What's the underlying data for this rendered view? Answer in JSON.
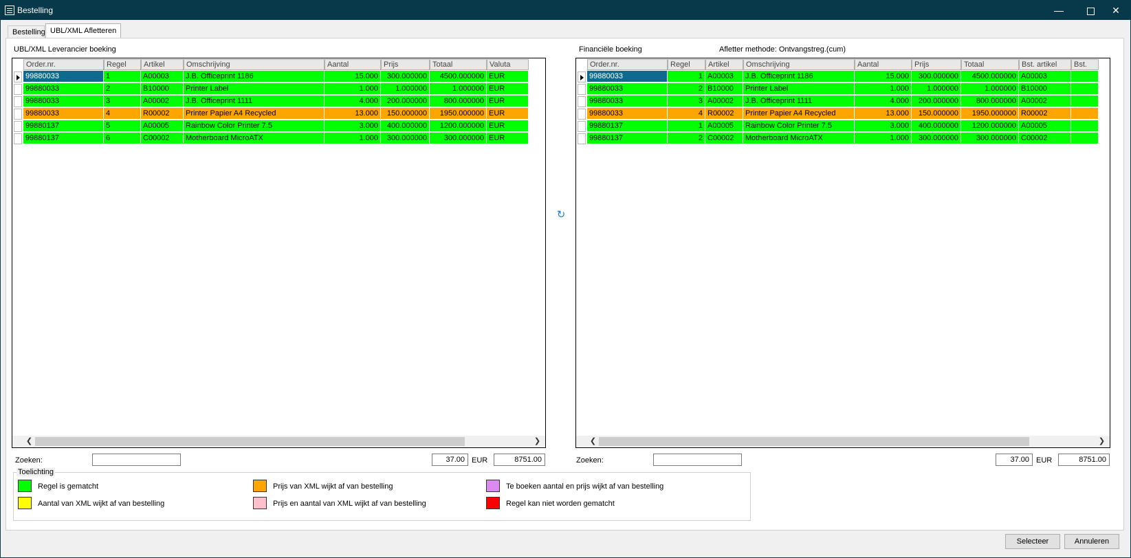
{
  "window": {
    "title": "Bestelling"
  },
  "tabs": [
    {
      "label": "Bestelling"
    },
    {
      "label": "UBL/XML Afletteren"
    }
  ],
  "left": {
    "title": "UBL/XML Leverancier boeking",
    "columns": [
      "Order.nr.",
      "Regel",
      "Artikel",
      "Omschrijving",
      "Aantal",
      "Prijs",
      "Totaal",
      "Valuta"
    ],
    "rows": [
      [
        "99880033",
        "1",
        "A00003",
        "J.B. Officeprint 1186",
        "15.000",
        "300.000000",
        "4500.000000",
        "EUR"
      ],
      [
        "99880033",
        "2",
        "B10000",
        "Printer Label",
        "1.000",
        "1.000000",
        "1.000000",
        "EUR"
      ],
      [
        "99880033",
        "3",
        "A00002",
        "J.B. Officeprint 1111",
        "4.000",
        "200.000000",
        "800.000000",
        "EUR"
      ],
      [
        "99880033",
        "4",
        "R00002",
        "Printer Papier A4 Recycled",
        "13.000",
        "150.000000",
        "1950.000000",
        "EUR"
      ],
      [
        "99880137",
        "5",
        "A00005",
        "Rainbow Color Printer 7.5",
        "3.000",
        "400.000000",
        "1200.000000",
        "EUR"
      ],
      [
        "99880137",
        "6",
        "C00002",
        "Motherboard MicroATX",
        "1.000",
        "300.000000",
        "300.000000",
        "EUR"
      ]
    ],
    "row_colors": [
      "#00ff00",
      "#00ff00",
      "#00ff00",
      "#ffa500",
      "#00ff00",
      "#00ff00"
    ],
    "search_label": "Zoeken:",
    "search_value": "",
    "count": "37.00",
    "currency": "EUR",
    "total": "8751.00"
  },
  "right": {
    "title": "Financiële boeking",
    "method": "Afletter methode: Ontvangstreg.(cum)",
    "columns": [
      "Order.nr.",
      "Regel",
      "Artikel",
      "Omschrijving",
      "Aantal",
      "Prijs",
      "Totaal",
      "Bst. artikel",
      "Bst."
    ],
    "rows": [
      [
        "99880033",
        "1",
        "A00003",
        "J.B. Officeprint 1186",
        "15.000",
        "300.000000",
        "4500.000000",
        "A00003",
        ""
      ],
      [
        "99880033",
        "2",
        "B10000",
        "Printer Label",
        "1.000",
        "1.000000",
        "1.000000",
        "B10000",
        ""
      ],
      [
        "99880033",
        "3",
        "A00002",
        "J.B. Officeprint 1111",
        "4.000",
        "200.000000",
        "800.000000",
        "A00002",
        ""
      ],
      [
        "99880033",
        "4",
        "R00002",
        "Printer Papier A4 Recycled",
        "13.000",
        "150.000000",
        "1950.000000",
        "R00002",
        ""
      ],
      [
        "99880137",
        "1",
        "A00005",
        "Rainbow Color Printer 7.5",
        "3.000",
        "400.000000",
        "1200.000000",
        "A00005",
        ""
      ],
      [
        "99880137",
        "2",
        "C00002",
        "Motherboard MicroATX",
        "1.000",
        "300.000000",
        "300.000000",
        "C00002",
        ""
      ]
    ],
    "row_colors": [
      "#00ff00",
      "#00ff00",
      "#00ff00",
      "#ffa500",
      "#00ff00",
      "#00ff00"
    ],
    "search_label": "Zoeken:",
    "search_value": "",
    "count": "37.00",
    "currency": "EUR",
    "total": "8751.00"
  },
  "legend": {
    "title": "Toelichting",
    "items": [
      {
        "color": "#00ff00",
        "text": "Regel is gematcht"
      },
      {
        "color": "#ffa500",
        "text": "Prijs van XML wijkt af van bestelling"
      },
      {
        "color": "#d98bef",
        "text": "Te boeken aantal en prijs wijkt af van bestelling"
      },
      {
        "color": "#ffff00",
        "text": "Aantal van XML wijkt af van bestelling"
      },
      {
        "color": "#ffc0cb",
        "text": "Prijs en aantal van XML wijkt af van bestelling"
      },
      {
        "color": "#ff0000",
        "text": "Regel kan niet worden gematcht"
      }
    ]
  },
  "buttons": {
    "select": "Selecteer",
    "cancel": "Annuleren"
  },
  "icons": {
    "link": "link-rows-icon"
  },
  "colors": {
    "selected_cell": "#0d6b8e",
    "titlebar": "#08394a"
  }
}
